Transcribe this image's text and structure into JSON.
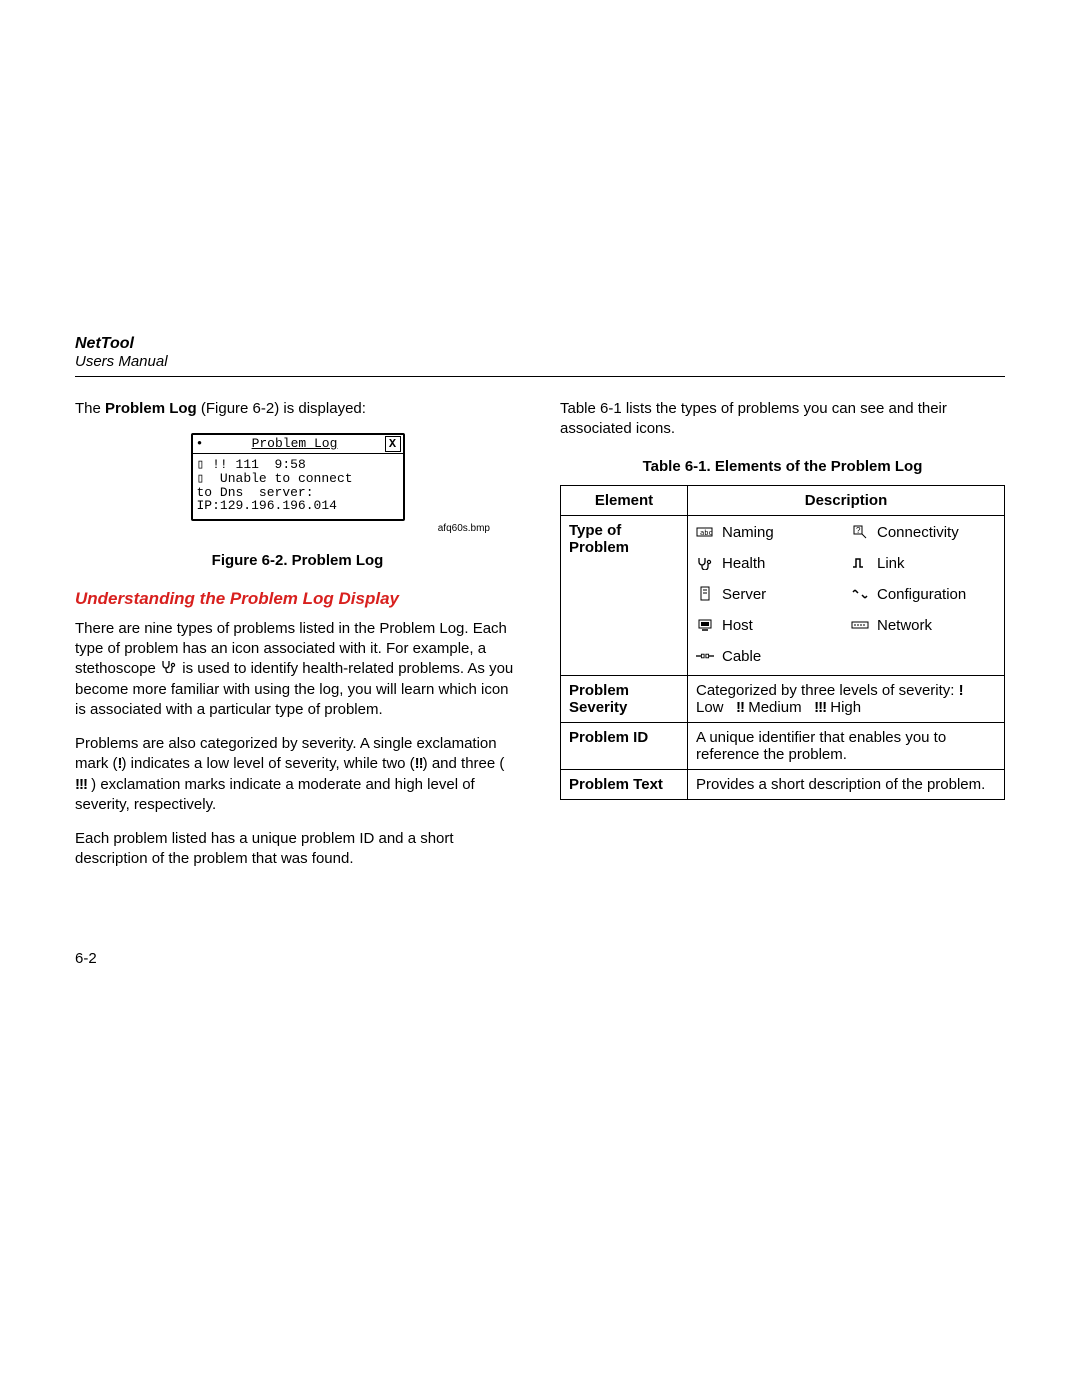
{
  "header": {
    "product": "NetTool",
    "subtitle": "Users Manual"
  },
  "left": {
    "intro_pre": "The ",
    "intro_bold": "Problem Log",
    "intro_post": " (Figure 6-2) is displayed:",
    "device": {
      "title": "Problem Log",
      "line1": "▯ !! 111  9:58",
      "line2": "▯  Unable to connect",
      "line3": "to Dns  server:",
      "line4": "IP:129.196.196.014"
    },
    "bmp": "afq60s.bmp",
    "figcap": "Figure 6-2. Problem Log",
    "section": "Understanding the Problem Log Display",
    "p1": "There are nine types of problems listed in the Problem Log. Each type of problem has an icon associated with it. For example, a stethoscope ",
    "p1b": " is used to identify health-related problems. As you become more familiar with using the log, you will learn which icon is associated with a particular type of problem.",
    "p2a": "Problems are also categorized by severity. A single exclamation mark (",
    "p2b": ") indicates a low level of severity, while two (",
    "p2c": ") and three (",
    "p2d": ") exclamation marks indicate a moderate and high level of severity, respectively.",
    "p3": "Each problem listed has a unique problem ID and a short description of the problem that was found."
  },
  "right": {
    "intro": "Table 6-1 lists the types of problems you can see and their associated icons.",
    "tablecap": "Table 6-1. Elements of the Problem Log",
    "th_el": "Element",
    "th_desc": "Description",
    "rows": {
      "type_label": "Type of Problem",
      "types": {
        "naming": "Naming",
        "connectivity": "Connectivity",
        "health": "Health",
        "link": "Link",
        "server": "Server",
        "configuration": "Configuration",
        "host": "Host",
        "network": "Network",
        "cable": "Cable"
      },
      "sev_label": "Problem Severity",
      "sev_desc_a": "Categorized by three levels of severity: ",
      "sev_low": "Low",
      "sev_med": "Medium",
      "sev_high": "High",
      "id_label": "Problem ID",
      "id_desc": "A unique identifier that enables you to reference the problem.",
      "text_label": "Problem Text",
      "text_desc": "Provides a short description of the problem."
    }
  },
  "pagenum": "6-2",
  "icons": {
    "low": "!",
    "med": "!!",
    "high": "!!!"
  }
}
